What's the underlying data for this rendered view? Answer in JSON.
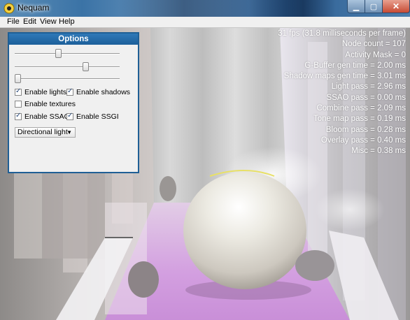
{
  "window": {
    "title": "Nequam"
  },
  "menu": {
    "items": [
      "File",
      "Edit",
      "View",
      "Help"
    ]
  },
  "hud": {
    "lines": [
      "31 fps (31.8 milliseconds per frame)",
      "Node count = 107",
      "Activity Mask = 0",
      "G-Buffer gen time = 2.00 ms",
      "Shadow maps gen time = 3.01 ms",
      "Light pass = 2.96 ms",
      "SSAO pass = 0.00 ms",
      "Combine pass = 2.09 ms",
      "Tone map pass = 0.19 ms",
      "Bloom pass = 0.28 ms",
      "Overlay pass = 0.40 ms",
      "Misc = 0.38 ms"
    ]
  },
  "options": {
    "title": "Options",
    "sliders": [
      {
        "value": 0.41
      },
      {
        "value": 0.69
      },
      {
        "value": 0.0
      }
    ],
    "enable_lights": {
      "label": "Enable lights",
      "checked": true
    },
    "enable_shadows": {
      "label": "Enable shadows",
      "checked": true
    },
    "enable_textures": {
      "label": "Enable textures",
      "checked": false
    },
    "enable_ssao": {
      "label": "Enable SSAO",
      "checked": true
    },
    "enable_ssgi": {
      "label": "Enable SSGI",
      "checked": true
    },
    "light_type": {
      "selected": "Directional light"
    }
  }
}
